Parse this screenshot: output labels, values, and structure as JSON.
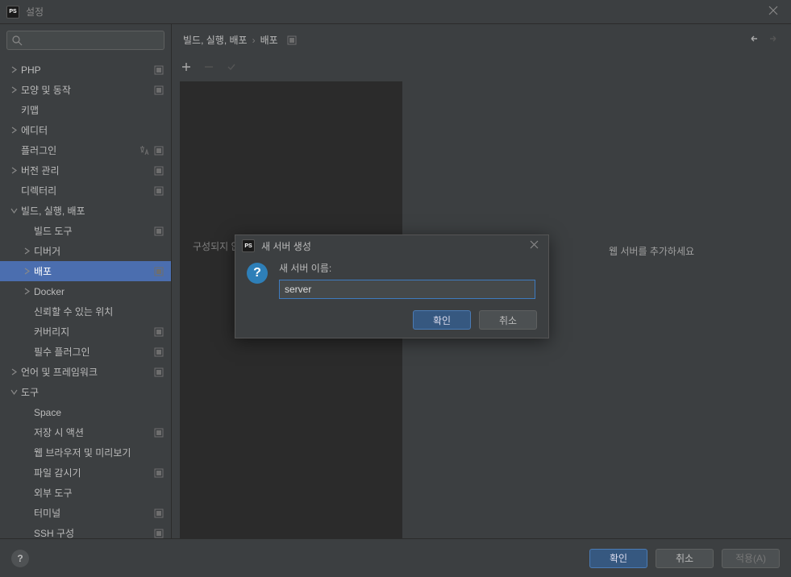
{
  "titlebar": {
    "title": "설정"
  },
  "search": {
    "placeholder": ""
  },
  "sidebar": {
    "items": [
      {
        "label": "PHP",
        "level": 1,
        "chevron": "right",
        "indicator": true
      },
      {
        "label": "모양 및 동작",
        "level": 1,
        "chevron": "right",
        "indicator": true
      },
      {
        "label": "키맵",
        "level": 1,
        "chevron": "",
        "indicator": false
      },
      {
        "label": "에디터",
        "level": 1,
        "chevron": "right",
        "indicator": false
      },
      {
        "label": "플러그인",
        "level": 1,
        "chevron": "",
        "indicator": true,
        "translate": true
      },
      {
        "label": "버전 관리",
        "level": 1,
        "chevron": "right",
        "indicator": true
      },
      {
        "label": "디렉터리",
        "level": 1,
        "chevron": "",
        "indicator": true
      },
      {
        "label": "빌드, 실행, 배포",
        "level": 1,
        "chevron": "down",
        "indicator": false
      },
      {
        "label": "빌드 도구",
        "level": 2,
        "chevron": "",
        "indicator": true
      },
      {
        "label": "디버거",
        "level": 2,
        "chevron": "right",
        "indicator": false
      },
      {
        "label": "배포",
        "level": 2,
        "chevron": "right",
        "indicator": true,
        "selected": true
      },
      {
        "label": "Docker",
        "level": 2,
        "chevron": "right",
        "indicator": false
      },
      {
        "label": "신뢰할 수 있는 위치",
        "level": 2,
        "chevron": "",
        "indicator": false
      },
      {
        "label": "커버리지",
        "level": 2,
        "chevron": "",
        "indicator": true
      },
      {
        "label": "필수 플러그인",
        "level": 2,
        "chevron": "",
        "indicator": true
      },
      {
        "label": "언어 및 프레임워크",
        "level": 1,
        "chevron": "right",
        "indicator": true
      },
      {
        "label": "도구",
        "level": 1,
        "chevron": "down",
        "indicator": false
      },
      {
        "label": "Space",
        "level": 2,
        "chevron": "",
        "indicator": false
      },
      {
        "label": "저장 시 액션",
        "level": 2,
        "chevron": "",
        "indicator": true
      },
      {
        "label": "웹 브라우저 및 미리보기",
        "level": 2,
        "chevron": "",
        "indicator": false
      },
      {
        "label": "파일 감시기",
        "level": 2,
        "chevron": "",
        "indicator": true
      },
      {
        "label": "외부 도구",
        "level": 2,
        "chevron": "",
        "indicator": false
      },
      {
        "label": "터미널",
        "level": 2,
        "chevron": "",
        "indicator": true
      },
      {
        "label": "SSH 구성",
        "level": 2,
        "chevron": "",
        "indicator": true
      }
    ]
  },
  "breadcrumb": {
    "part1": "빌드, 실행, 배포",
    "part2": "배포"
  },
  "editor": {
    "message": "구성되지 않았습니다"
  },
  "hint": {
    "text": "웹 서버를 추가하세요"
  },
  "modal": {
    "title": "새 서버 생성",
    "label": "새 서버 이름:",
    "value": "server",
    "ok": "확인",
    "cancel": "취소"
  },
  "footer": {
    "ok": "확인",
    "cancel": "취소",
    "apply": "적용(A)"
  }
}
